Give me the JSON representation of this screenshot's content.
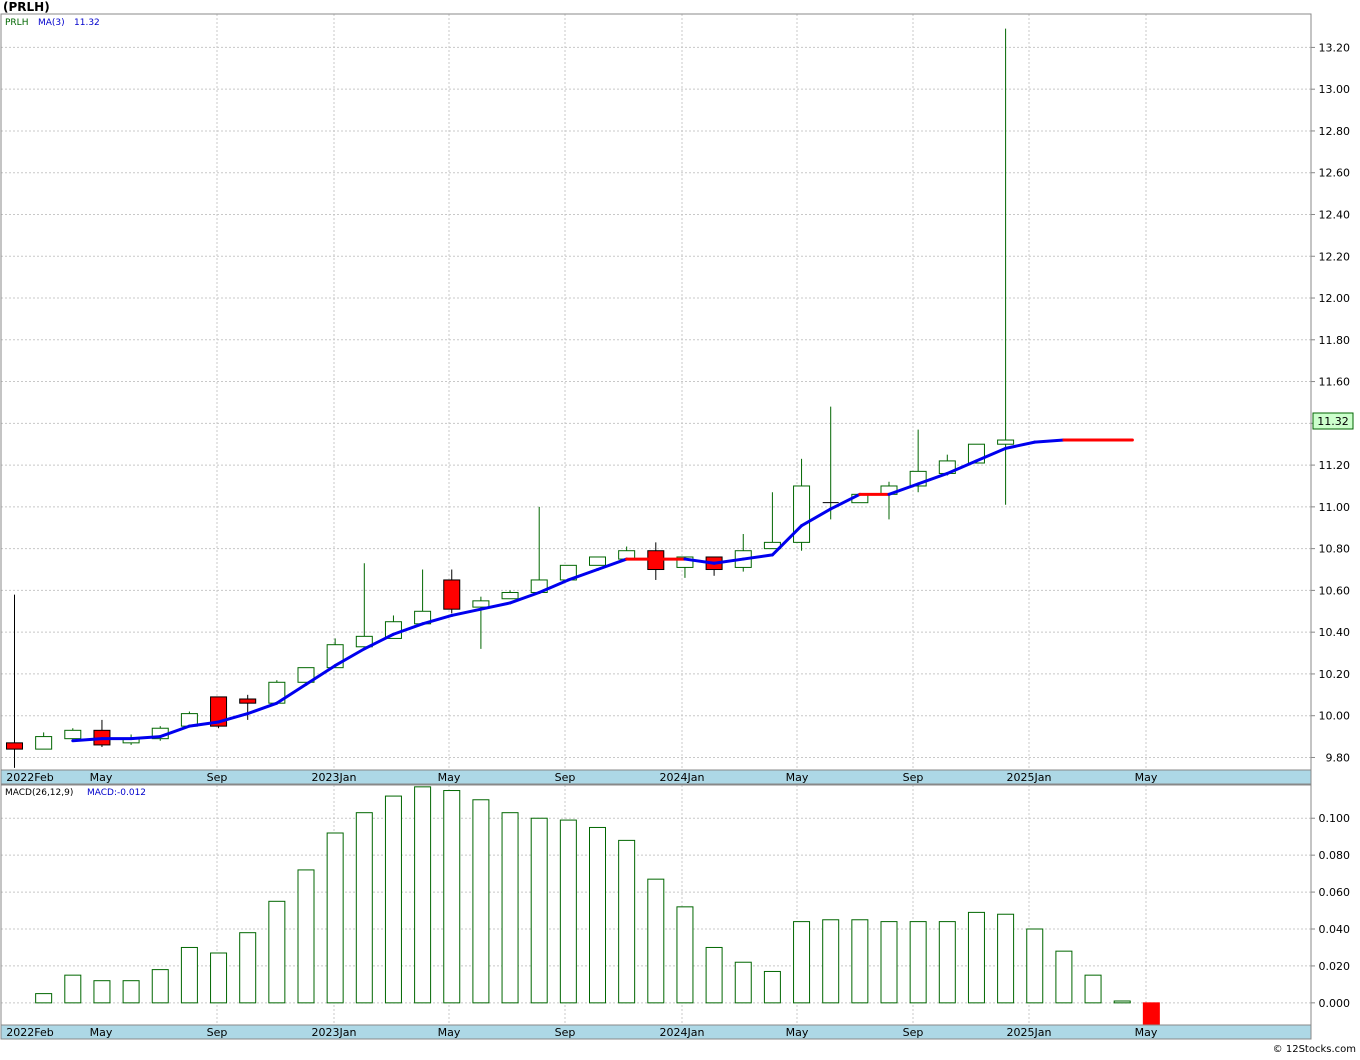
{
  "header": {
    "symbol_title": "(PRLH)"
  },
  "legend": {
    "ticker": "PRLH",
    "ma_label": "MA(3)",
    "ma_value": "11.32",
    "macd_label": "MACD(26,12,9)",
    "macd_value": "MACD:-0.012"
  },
  "price_tag": "11.32",
  "footer": {
    "copyright": "© 12Stocks.com"
  },
  "colors": {
    "up_candle": "#006600",
    "down_candle": "#ff0000",
    "ma_up": "#0000ee",
    "ma_down": "#ff0000",
    "grid": "#c8c8c8",
    "axis_band": "#add8e6",
    "price_tag_bg": "#ccffcc"
  },
  "chart_data": [
    {
      "type": "candlestick",
      "title": "(PRLH)",
      "ylim": [
        9.74,
        13.36
      ],
      "y_ticks": [
        "9.80",
        "10.00",
        "10.20",
        "10.40",
        "10.60",
        "10.80",
        "11.00",
        "11.20",
        "11.40",
        "11.60",
        "11.80",
        "12.00",
        "12.20",
        "12.40",
        "12.60",
        "12.80",
        "13.00",
        "13.20"
      ],
      "x_tick_labels": [
        "2022Feb",
        "May",
        "Sep",
        "2023Jan",
        "May",
        "Sep",
        "2024Jan",
        "May",
        "Sep",
        "2025Jan",
        "May"
      ],
      "grid": true,
      "candles": [
        {
          "o": 9.87,
          "h": 10.58,
          "l": 9.75,
          "c": 9.84
        },
        {
          "o": 9.84,
          "h": 9.92,
          "l": 9.84,
          "c": 9.9
        },
        {
          "o": 9.89,
          "h": 9.94,
          "l": 9.88,
          "c": 9.93
        },
        {
          "o": 9.93,
          "h": 9.98,
          "l": 9.85,
          "c": 9.86
        },
        {
          "o": 9.87,
          "h": 9.91,
          "l": 9.86,
          "c": 9.89
        },
        {
          "o": 9.89,
          "h": 9.95,
          "l": 9.88,
          "c": 9.94
        },
        {
          "o": 9.95,
          "h": 10.02,
          "l": 9.95,
          "c": 10.01
        },
        {
          "o": 10.09,
          "h": 10.09,
          "l": 9.94,
          "c": 9.95
        },
        {
          "o": 10.08,
          "h": 10.1,
          "l": 9.98,
          "c": 10.06
        },
        {
          "o": 10.06,
          "h": 10.17,
          "l": 10.06,
          "c": 10.16
        },
        {
          "o": 10.16,
          "h": 10.23,
          "l": 10.16,
          "c": 10.23
        },
        {
          "o": 10.23,
          "h": 10.37,
          "l": 10.23,
          "c": 10.34
        },
        {
          "o": 10.33,
          "h": 10.73,
          "l": 10.33,
          "c": 10.38
        },
        {
          "o": 10.37,
          "h": 10.48,
          "l": 10.37,
          "c": 10.45
        },
        {
          "o": 10.44,
          "h": 10.7,
          "l": 10.44,
          "c": 10.5
        },
        {
          "o": 10.65,
          "h": 10.7,
          "l": 10.49,
          "c": 10.51
        },
        {
          "o": 10.52,
          "h": 10.57,
          "l": 10.32,
          "c": 10.55
        },
        {
          "o": 10.56,
          "h": 10.6,
          "l": 10.56,
          "c": 10.59
        },
        {
          "o": 10.59,
          "h": 11.0,
          "l": 10.59,
          "c": 10.65
        },
        {
          "o": 10.65,
          "h": 10.72,
          "l": 10.65,
          "c": 10.72
        },
        {
          "o": 10.72,
          "h": 10.76,
          "l": 10.72,
          "c": 10.76
        },
        {
          "o": 10.75,
          "h": 10.81,
          "l": 10.75,
          "c": 10.79
        },
        {
          "o": 10.79,
          "h": 10.83,
          "l": 10.65,
          "c": 10.7
        },
        {
          "o": 10.71,
          "h": 10.76,
          "l": 10.66,
          "c": 10.76
        },
        {
          "o": 10.76,
          "h": 10.76,
          "l": 10.67,
          "c": 10.7
        },
        {
          "o": 10.71,
          "h": 10.87,
          "l": 10.69,
          "c": 10.79
        },
        {
          "o": 10.8,
          "h": 11.07,
          "l": 10.8,
          "c": 10.83
        },
        {
          "o": 10.83,
          "h": 11.23,
          "l": 10.79,
          "c": 11.1
        },
        {
          "o": 11.02,
          "h": 11.48,
          "l": 10.94,
          "c": 11.02
        },
        {
          "o": 11.02,
          "h": 11.06,
          "l": 11.02,
          "c": 11.06
        },
        {
          "o": 11.06,
          "h": 11.12,
          "l": 10.94,
          "c": 11.1
        },
        {
          "o": 11.1,
          "h": 11.37,
          "l": 11.07,
          "c": 11.17
        },
        {
          "o": 11.16,
          "h": 11.25,
          "l": 11.15,
          "c": 11.22
        },
        {
          "o": 11.21,
          "h": 11.3,
          "l": 11.21,
          "c": 11.3
        },
        {
          "o": 11.3,
          "h": 13.29,
          "l": 11.01,
          "c": 11.32
        },
        null,
        null,
        null,
        {
          "o": 11.32,
          "h": 11.32,
          "l": 11.32,
          "c": 11.32
        }
      ],
      "ma_series": {
        "name": "MA(3)",
        "points": [
          [
            2,
            9.88
          ],
          [
            3,
            9.89
          ],
          [
            4,
            9.89
          ],
          [
            5,
            9.9
          ],
          [
            6,
            9.95
          ],
          [
            7,
            9.97
          ],
          [
            8,
            10.01
          ],
          [
            9,
            10.06
          ],
          [
            10,
            10.15
          ],
          [
            11,
            10.24
          ],
          [
            12,
            10.32
          ],
          [
            13,
            10.39
          ],
          [
            14,
            10.44
          ],
          [
            15,
            10.48
          ],
          [
            16,
            10.51
          ],
          [
            17,
            10.54
          ],
          [
            18,
            10.59
          ],
          [
            19,
            10.65
          ],
          [
            20,
            10.7
          ],
          [
            21,
            10.75
          ],
          [
            22,
            10.75
          ],
          [
            23,
            10.75
          ],
          [
            24,
            10.73
          ],
          [
            25,
            10.75
          ],
          [
            26,
            10.77
          ],
          [
            27,
            10.91
          ],
          [
            28,
            10.99
          ],
          [
            29,
            11.06
          ],
          [
            30,
            11.06
          ],
          [
            31,
            11.11
          ],
          [
            32,
            11.16
          ],
          [
            33,
            11.22
          ],
          [
            34,
            11.28
          ],
          [
            35,
            11.31
          ],
          [
            36,
            11.32
          ],
          [
            37,
            11.32
          ],
          [
            38,
            11.32
          ],
          [
            38.35,
            11.32
          ]
        ],
        "down_segments": [
          [
            21,
            23
          ],
          [
            29,
            30
          ],
          [
            36,
            38.35
          ]
        ]
      }
    },
    {
      "type": "bar",
      "title": "MACD(26,12,9)",
      "ylim": [
        -0.012,
        0.118
      ],
      "y_ticks": [
        "0.000",
        "0.020",
        "0.040",
        "0.060",
        "0.080",
        "0.100"
      ],
      "x_tick_labels": [
        "2022Feb",
        "May",
        "Sep",
        "2023Jan",
        "May",
        "Sep",
        "2024Jan",
        "May",
        "Sep",
        "2025Jan",
        "May"
      ],
      "values": [
        null,
        0.005,
        0.015,
        0.012,
        0.012,
        0.018,
        0.03,
        0.027,
        0.038,
        0.055,
        0.072,
        0.092,
        0.103,
        0.112,
        0.117,
        0.115,
        0.11,
        0.103,
        0.1,
        0.099,
        0.095,
        0.088,
        0.067,
        0.052,
        0.03,
        0.022,
        0.017,
        0.044,
        0.045,
        0.045,
        0.044,
        0.044,
        0.044,
        0.049,
        0.048,
        0.04,
        0.028,
        0.015,
        0.001,
        -0.012
      ]
    }
  ]
}
